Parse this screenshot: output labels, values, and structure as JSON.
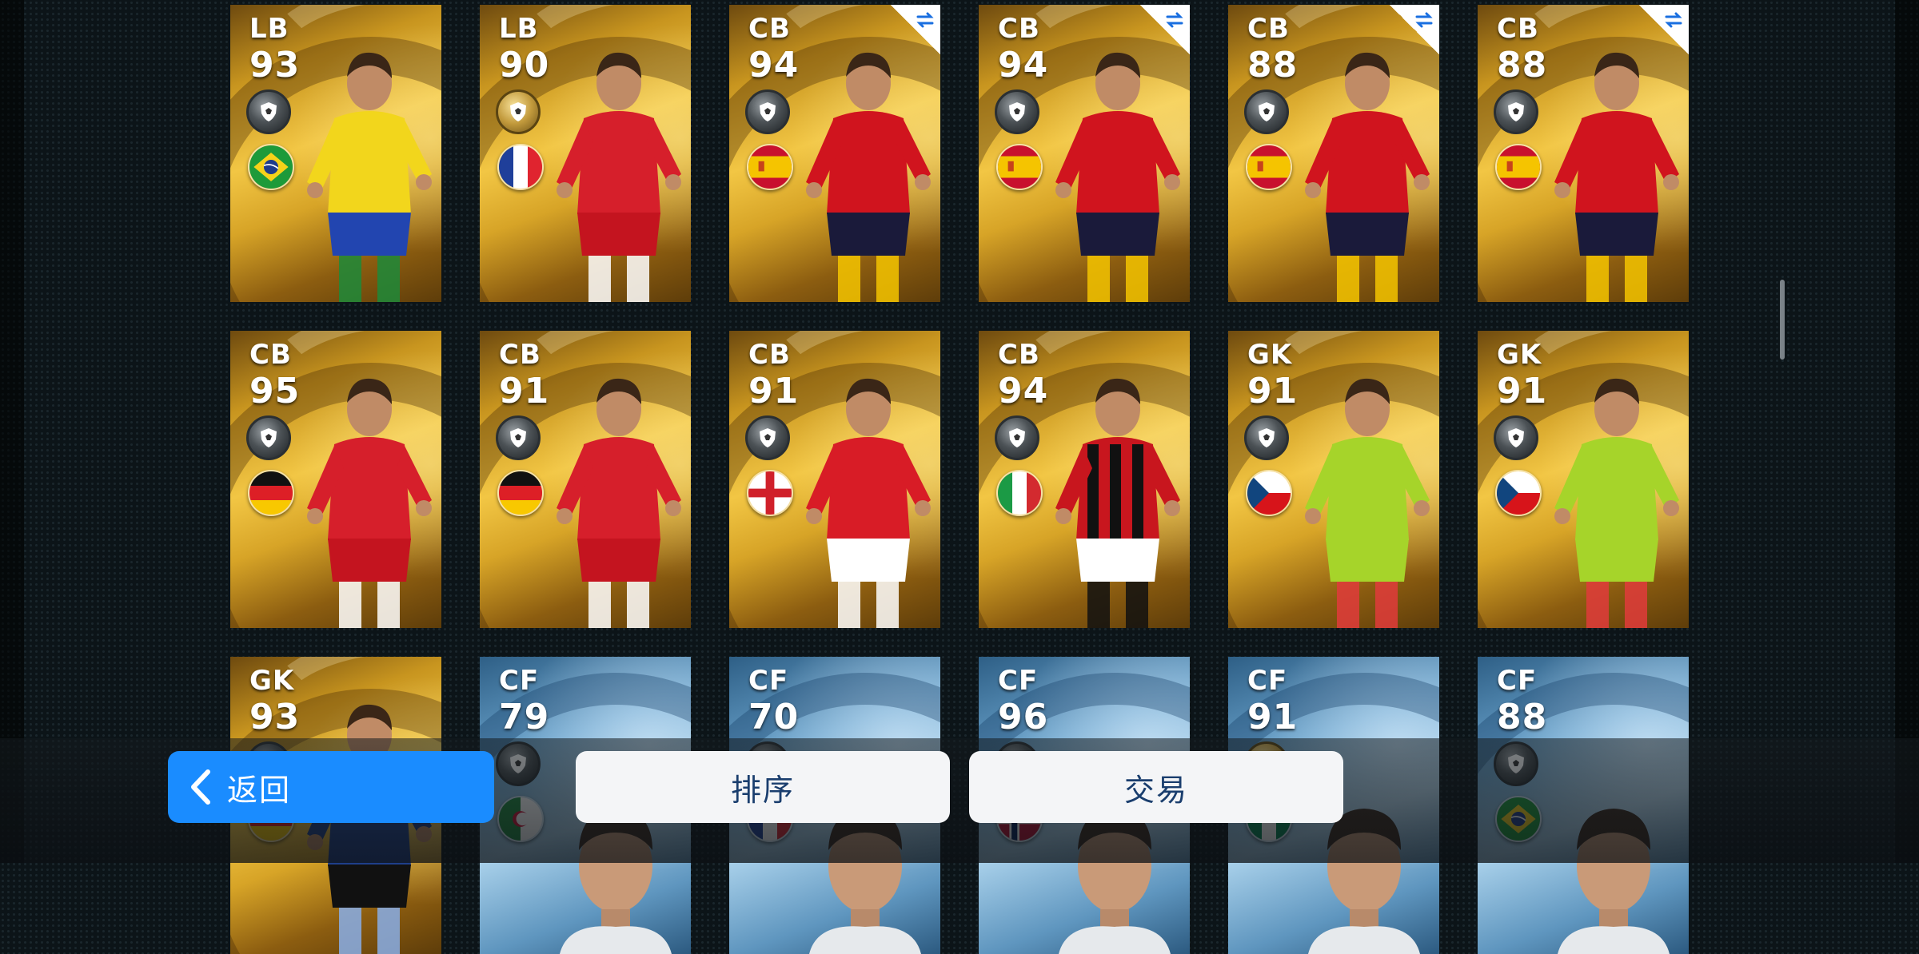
{
  "cards": [
    {
      "position": "LB",
      "rating": "93",
      "style": "gold",
      "badge": "silver",
      "flag": "brazil",
      "swap": false,
      "kit": "brazil-yellow",
      "player_icon": "player-kicking-icon"
    },
    {
      "position": "LB",
      "rating": "90",
      "style": "gold",
      "badge": "gold",
      "flag": "france",
      "swap": false,
      "kit": "bayern-red",
      "player_icon": "player-running-icon"
    },
    {
      "position": "CB",
      "rating": "94",
      "style": "gold",
      "badge": "silver",
      "flag": "spain",
      "swap": true,
      "kit": "spain-red",
      "player_icon": "player-shouting-icon"
    },
    {
      "position": "CB",
      "rating": "94",
      "style": "gold",
      "badge": "silver",
      "flag": "spain",
      "swap": true,
      "kit": "spain-red",
      "player_icon": "player-shouting-icon"
    },
    {
      "position": "CB",
      "rating": "88",
      "style": "gold",
      "badge": "silver",
      "flag": "spain",
      "swap": true,
      "kit": "spain-red",
      "player_icon": "player-shouting-icon"
    },
    {
      "position": "CB",
      "rating": "88",
      "style": "gold",
      "badge": "silver",
      "flag": "spain",
      "swap": true,
      "kit": "spain-red",
      "player_icon": "player-shouting-icon"
    },
    {
      "position": "CB",
      "rating": "95",
      "style": "gold",
      "badge": "silver",
      "flag": "germany",
      "swap": false,
      "kit": "bayern-red",
      "player_icon": "player-standing-icon"
    },
    {
      "position": "CB",
      "rating": "91",
      "style": "gold",
      "badge": "silver",
      "flag": "germany",
      "swap": false,
      "kit": "bayern-red",
      "player_icon": "player-standing-icon"
    },
    {
      "position": "CB",
      "rating": "91",
      "style": "gold",
      "badge": "silver",
      "flag": "england",
      "swap": false,
      "kit": "arsenal-red",
      "player_icon": "player-running-icon"
    },
    {
      "position": "CB",
      "rating": "94",
      "style": "gold",
      "badge": "silver",
      "flag": "italy",
      "swap": false,
      "kit": "milan-stripes",
      "player_icon": "player-running-icon"
    },
    {
      "position": "GK",
      "rating": "91",
      "style": "gold",
      "badge": "silver",
      "flag": "czech",
      "swap": false,
      "kit": "gk-green",
      "player_icon": "goalkeeper-icon"
    },
    {
      "position": "GK",
      "rating": "91",
      "style": "gold",
      "badge": "silver",
      "flag": "czech",
      "swap": false,
      "kit": "gk-green",
      "player_icon": "goalkeeper-icon"
    },
    {
      "position": "GK",
      "rating": "93",
      "style": "gold",
      "badge": "silver",
      "flag": "germany",
      "swap": false,
      "kit": "gk-blue",
      "player_icon": "goalkeeper-icon"
    },
    {
      "position": "CF",
      "rating": "79",
      "style": "blue",
      "badge": "silver",
      "flag": "algeria",
      "swap": false,
      "kit": "head",
      "player_icon": "player-headshot-icon"
    },
    {
      "position": "CF",
      "rating": "70",
      "style": "blue",
      "badge": "silver",
      "flag": "france",
      "swap": false,
      "kit": "head",
      "player_icon": "player-headshot-icon"
    },
    {
      "position": "CF",
      "rating": "96",
      "style": "blue",
      "badge": "silver",
      "flag": "norway",
      "swap": false,
      "kit": "head",
      "player_icon": "player-headshot-icon"
    },
    {
      "position": "CF",
      "rating": "91",
      "style": "blue",
      "badge": "gold",
      "flag": "nigeria",
      "swap": false,
      "kit": "head",
      "player_icon": "player-headshot-icon"
    },
    {
      "position": "CF",
      "rating": "88",
      "style": "blue",
      "badge": "silver",
      "flag": "brazil",
      "swap": false,
      "kit": "head",
      "player_icon": "player-headshot-icon"
    }
  ],
  "bottom_bar": {
    "back_label": "返回",
    "sort_label": "排序",
    "trade_label": "交易"
  },
  "colors": {
    "accent_blue": "#1a8cff",
    "button_text": "#1a3e6e",
    "background": "#0c1418"
  }
}
